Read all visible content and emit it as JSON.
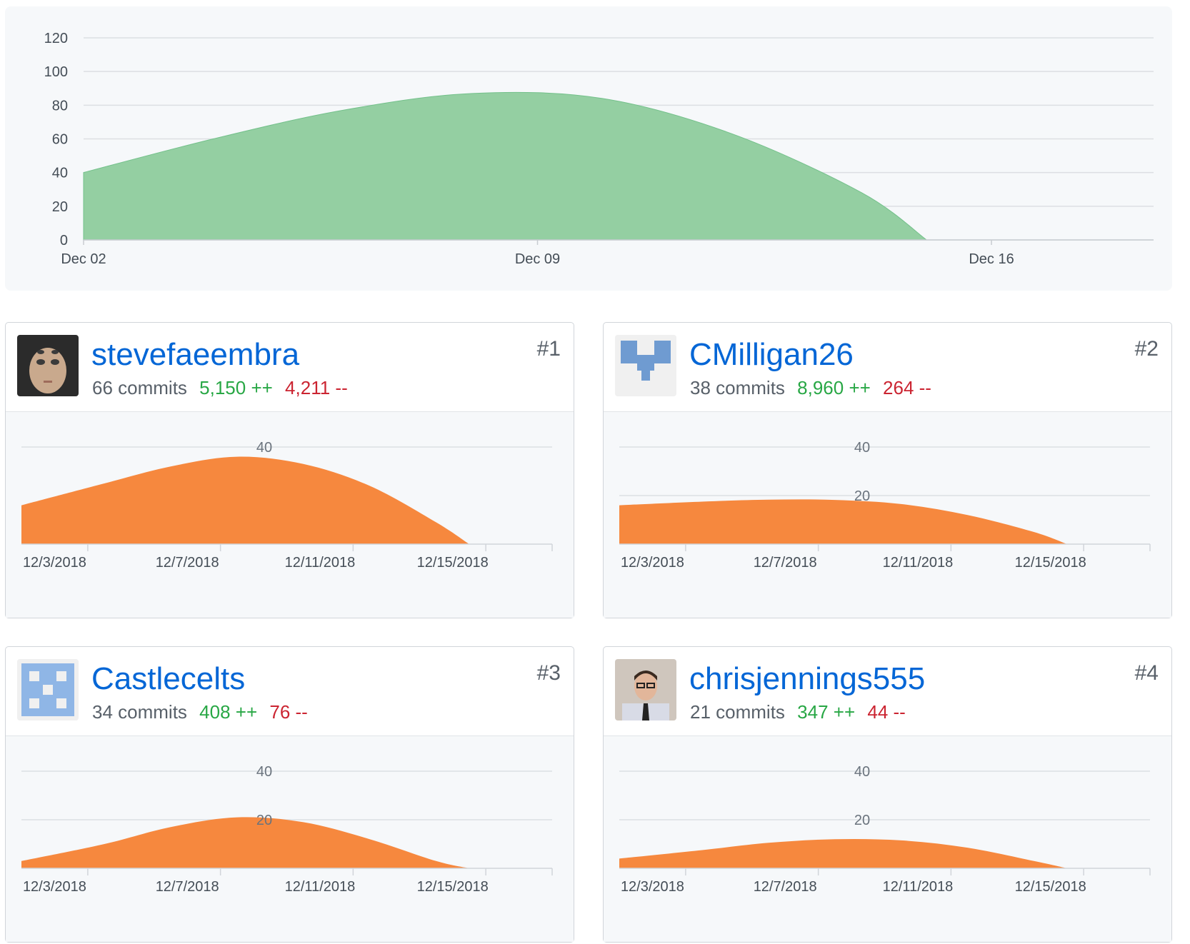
{
  "overview": {
    "chart_data": {
      "type": "area",
      "x": [
        "Dec 02",
        "Dec 04",
        "Dec 06",
        "Dec 08",
        "Dec 10",
        "Dec 12",
        "Dec 14",
        "Dec 15"
      ],
      "x_day": [
        2,
        4,
        6,
        8,
        10,
        12,
        14,
        15
      ],
      "values": [
        40,
        60,
        77,
        87,
        84,
        63,
        28,
        0
      ],
      "x_ticks": [
        "Dec 02",
        "Dec 09",
        "Dec 16"
      ],
      "x_tick_days": [
        2,
        9,
        16
      ],
      "y_ticks": [
        0,
        20,
        40,
        60,
        80,
        100,
        120
      ],
      "ylim": [
        0,
        120
      ],
      "xlim": [
        2,
        18.5
      ],
      "grid": true,
      "colors": {
        "fill": "#94cfa2",
        "stroke": "#73c08a"
      }
    }
  },
  "contributors": [
    {
      "username": "stevefaeembra",
      "rank": "#1",
      "commits": "66 commits",
      "additions": "5,150 ++",
      "deletions": "4,211 --",
      "avatar_icon": "portrait-avatar-icon",
      "chart_data": {
        "type": "area",
        "x": [
          "12/2/2018",
          "12/4/2018",
          "12/6/2018",
          "12/8/2018",
          "12/10/2018",
          "12/12/2018",
          "12/14/2018",
          "12/15/2018"
        ],
        "x_day": [
          2,
          4,
          6,
          8,
          10,
          12,
          14,
          15
        ],
        "values": [
          16,
          25,
          32,
          36,
          33,
          24,
          9,
          0
        ],
        "x_ticks": [
          "12/3/2018",
          "12/7/2018",
          "12/11/2018",
          "12/15/2018"
        ],
        "x_tick_days": [
          3,
          7,
          11,
          15
        ],
        "y_ticks": [
          40
        ],
        "ylim": [
          0,
          40
        ],
        "xlim": [
          1.5,
          17.5
        ],
        "colors": {
          "fill": "#f6883e"
        }
      }
    },
    {
      "username": "CMilligan26",
      "rank": "#2",
      "commits": "38 commits",
      "additions": "8,960 ++",
      "deletions": "264 --",
      "avatar_icon": "identicon-avatar-icon",
      "chart_data": {
        "type": "area",
        "x": [
          "12/2/2018",
          "12/4/2018",
          "12/6/2018",
          "12/8/2018",
          "12/10/2018",
          "12/12/2018",
          "12/14/2018",
          "12/15/2018"
        ],
        "x_day": [
          2,
          4,
          6,
          8,
          10,
          12,
          14,
          15
        ],
        "values": [
          16,
          17.5,
          18.3,
          18.2,
          16.5,
          12,
          5,
          0
        ],
        "x_ticks": [
          "12/3/2018",
          "12/7/2018",
          "12/11/2018",
          "12/15/2018"
        ],
        "x_tick_days": [
          3,
          7,
          11,
          15
        ],
        "y_ticks": [
          20,
          40
        ],
        "ylim": [
          0,
          40
        ],
        "xlim": [
          1.5,
          17.5
        ],
        "colors": {
          "fill": "#f6883e"
        }
      }
    },
    {
      "username": "Castlecelts",
      "rank": "#3",
      "commits": "34 commits",
      "additions": "408 ++",
      "deletions": "76 --",
      "avatar_icon": "identicon-avatar-icon",
      "chart_data": {
        "type": "area",
        "x": [
          "12/2/2018",
          "12/4/2018",
          "12/6/2018",
          "12/8/2018",
          "12/10/2018",
          "12/12/2018",
          "12/14/2018",
          "12/15/2018"
        ],
        "x_day": [
          2,
          4,
          6,
          8,
          10,
          12,
          14,
          15
        ],
        "values": [
          3,
          10,
          17,
          21,
          19,
          12,
          3,
          0
        ],
        "x_ticks": [
          "12/3/2018",
          "12/7/2018",
          "12/11/2018",
          "12/15/2018"
        ],
        "x_tick_days": [
          3,
          7,
          11,
          15
        ],
        "y_ticks": [
          20,
          40
        ],
        "ylim": [
          0,
          40
        ],
        "xlim": [
          1.5,
          17.5
        ],
        "colors": {
          "fill": "#f6883e"
        }
      }
    },
    {
      "username": "chrisjennings555",
      "rank": "#4",
      "commits": "21 commits",
      "additions": "347 ++",
      "deletions": "44 --",
      "avatar_icon": "portrait-avatar-icon",
      "chart_data": {
        "type": "area",
        "x": [
          "12/2/2018",
          "12/4/2018",
          "12/6/2018",
          "12/8/2018",
          "12/10/2018",
          "12/12/2018",
          "12/14/2018",
          "12/15/2018"
        ],
        "x_day": [
          2,
          4,
          6,
          8,
          10,
          12,
          14,
          15
        ],
        "values": [
          4,
          7.5,
          10.5,
          12,
          11.5,
          8.5,
          3,
          0
        ],
        "x_ticks": [
          "12/3/2018",
          "12/7/2018",
          "12/11/2018",
          "12/15/2018"
        ],
        "x_tick_days": [
          3,
          7,
          11,
          15
        ],
        "y_ticks": [
          20,
          40
        ],
        "ylim": [
          0,
          40
        ],
        "xlim": [
          1.5,
          17.5
        ],
        "colors": {
          "fill": "#f6883e"
        }
      }
    }
  ]
}
